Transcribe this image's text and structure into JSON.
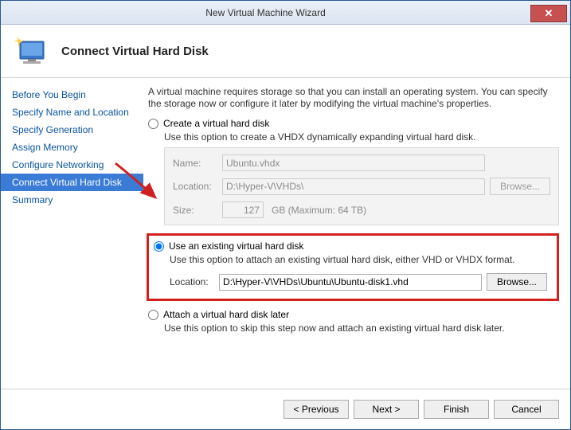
{
  "window": {
    "title": "New Virtual Machine Wizard"
  },
  "header": {
    "title": "Connect Virtual Hard Disk"
  },
  "sidebar": {
    "items": [
      {
        "label": "Before You Begin"
      },
      {
        "label": "Specify Name and Location"
      },
      {
        "label": "Specify Generation"
      },
      {
        "label": "Assign Memory"
      },
      {
        "label": "Configure Networking"
      },
      {
        "label": "Connect Virtual Hard Disk"
      },
      {
        "label": "Summary"
      }
    ],
    "active_index": 5
  },
  "content": {
    "intro": "A virtual machine requires storage so that you can install an operating system. You can specify the storage now or configure it later by modifying the virtual machine's properties.",
    "option_create": {
      "label": "Create a virtual hard disk",
      "desc": "Use this option to create a VHDX dynamically expanding virtual hard disk.",
      "name_label": "Name:",
      "name_value": "Ubuntu.vhdx",
      "location_label": "Location:",
      "location_value": "D:\\Hyper-V\\VHDs\\",
      "browse_label": "Browse...",
      "size_label": "Size:",
      "size_value": "127",
      "size_suffix": "GB (Maximum: 64 TB)"
    },
    "option_existing": {
      "label": "Use an existing virtual hard disk",
      "desc": "Use this option to attach an existing virtual hard disk, either VHD or VHDX format.",
      "location_label": "Location:",
      "location_value": "D:\\Hyper-V\\VHDs\\Ubuntu\\Ubuntu-disk1.vhd",
      "browse_label": "Browse..."
    },
    "option_later": {
      "label": "Attach a virtual hard disk later",
      "desc": "Use this option to skip this step now and attach an existing virtual hard disk later."
    },
    "selected_option": "existing"
  },
  "footer": {
    "previous": "< Previous",
    "next": "Next >",
    "finish": "Finish",
    "cancel": "Cancel"
  }
}
